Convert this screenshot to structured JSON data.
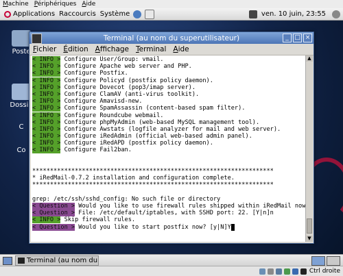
{
  "vm_menu": [
    "Machine",
    "Périphériques",
    "Aide"
  ],
  "top_panel": {
    "applications": "Applications",
    "raccourcis": "Raccourcis",
    "systeme": "Système",
    "clock": "ven. 10 juin, 23:55"
  },
  "desktop": {
    "icons": [
      "Poste",
      "Dossie",
      "C",
      "Co"
    ]
  },
  "terminal": {
    "title": "Terminal (au nom du superutilisateur)",
    "menu": [
      "Fichier",
      "Édition",
      "Affichage",
      "Terminal",
      "Aide"
    ],
    "lines": [
      {
        "tag": "< INFO >",
        "kind": "info",
        "text": " Configure User/Group: vmail."
      },
      {
        "tag": "< INFO >",
        "kind": "info",
        "text": " Configure Apache web server and PHP."
      },
      {
        "tag": "< INFO >",
        "kind": "info",
        "text": " Configure Postfix."
      },
      {
        "tag": "< INFO >",
        "kind": "info",
        "text": " Configure Policyd (postfix policy daemon)."
      },
      {
        "tag": "< INFO >",
        "kind": "info",
        "text": " Configure Dovecot (pop3/imap server)."
      },
      {
        "tag": "< INFO >",
        "kind": "info",
        "text": " Configure ClamAV (anti-virus toolkit)."
      },
      {
        "tag": "< INFO >",
        "kind": "info",
        "text": " Configure Amavisd-new."
      },
      {
        "tag": "< INFO >",
        "kind": "info",
        "text": " Configure SpamAssassin (content-based spam filter)."
      },
      {
        "tag": "< INFO >",
        "kind": "info",
        "text": " Configure Roundcube webmail."
      },
      {
        "tag": "< INFO >",
        "kind": "info",
        "text": " Configure phpMyAdmin (web-based MySQL management tool)."
      },
      {
        "tag": "< INFO >",
        "kind": "info",
        "text": " Configure Awstats (logfile analyzer for mail and web server)."
      },
      {
        "tag": "< INFO >",
        "kind": "info",
        "text": " Configure iRedAdmin (official web-based admin panel)."
      },
      {
        "tag": "< INFO >",
        "kind": "info",
        "text": " Configure iRedAPD (postfix policy daemon)."
      },
      {
        "tag": "< INFO >",
        "kind": "info",
        "text": " Configure Fail2ban."
      },
      {
        "tag": "",
        "kind": "plain",
        "text": ""
      },
      {
        "tag": "",
        "kind": "plain",
        "text": ""
      },
      {
        "tag": "",
        "kind": "plain",
        "text": "********************************************************************"
      },
      {
        "tag": "",
        "kind": "plain",
        "text": "* iRedMail-0.7.2 installation and configuration complete."
      },
      {
        "tag": "",
        "kind": "plain",
        "text": "********************************************************************"
      },
      {
        "tag": "",
        "kind": "plain",
        "text": ""
      },
      {
        "tag": "",
        "kind": "plain",
        "text": "grep: /etc/ssh/sshd_config: No such file or directory"
      },
      {
        "tag": "< Question >",
        "kind": "q",
        "text": " Would you like to use firewall rules shipped within iRedMail now?"
      },
      {
        "tag": "< Question >",
        "kind": "q",
        "text": " File: /etc/default/iptables, with SSHD port: 22. [Y|n]n"
      },
      {
        "tag": "< INFO >",
        "kind": "info",
        "text": " Skip firewall rules."
      },
      {
        "tag": "< Question >",
        "kind": "q",
        "text": " Would you like to start postfix now? [y|N]Y"
      }
    ]
  },
  "taskbar": {
    "task_label": "Terminal (au nom du ..."
  },
  "vm_status": {
    "host_key": "Ctrl droite"
  },
  "colors": {
    "info_tag": "#55a12a",
    "question_tag": "#8a4a92",
    "titlebar": "#5b84c4"
  }
}
